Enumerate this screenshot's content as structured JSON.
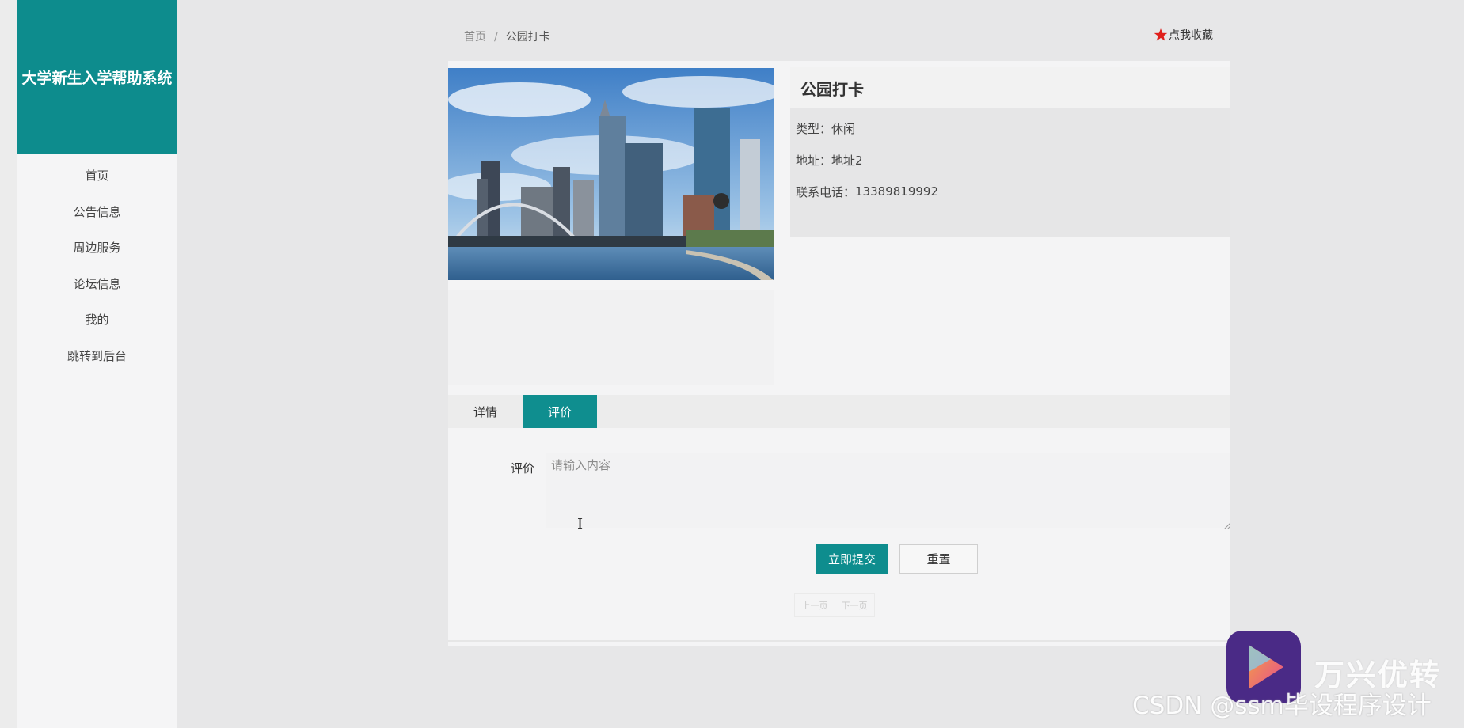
{
  "sidebar": {
    "brand": "大学新生入学帮助系统",
    "items": [
      "首页",
      "公告信息",
      "周边服务",
      "论坛信息",
      "我的",
      "跳转到后台"
    ]
  },
  "breadcrumb": {
    "home": "首页",
    "separator": "/",
    "current": "公园打卡"
  },
  "favorite": {
    "label": "点我收藏",
    "icon": "star-icon",
    "color": "#e0201c"
  },
  "detail": {
    "title": "公园打卡",
    "rows": [
      {
        "label": "类型：",
        "value": "休闲"
      },
      {
        "label": "地址：",
        "value": "地址2"
      },
      {
        "label": "联系电话：",
        "value": "13389819992"
      }
    ]
  },
  "tabs": [
    {
      "label": "详情",
      "active": false
    },
    {
      "label": "评价",
      "active": true
    }
  ],
  "review": {
    "label": "评价",
    "placeholder": "请输入内容",
    "submit_label": "立即提交",
    "reset_label": "重置"
  },
  "pager": {
    "prev": "上一页",
    "next": "下一页"
  },
  "watermark": {
    "brand": "万兴优转",
    "csdn": "CSDN @ssm毕设程序设计"
  },
  "colors": {
    "accent": "#0e8d8e"
  }
}
